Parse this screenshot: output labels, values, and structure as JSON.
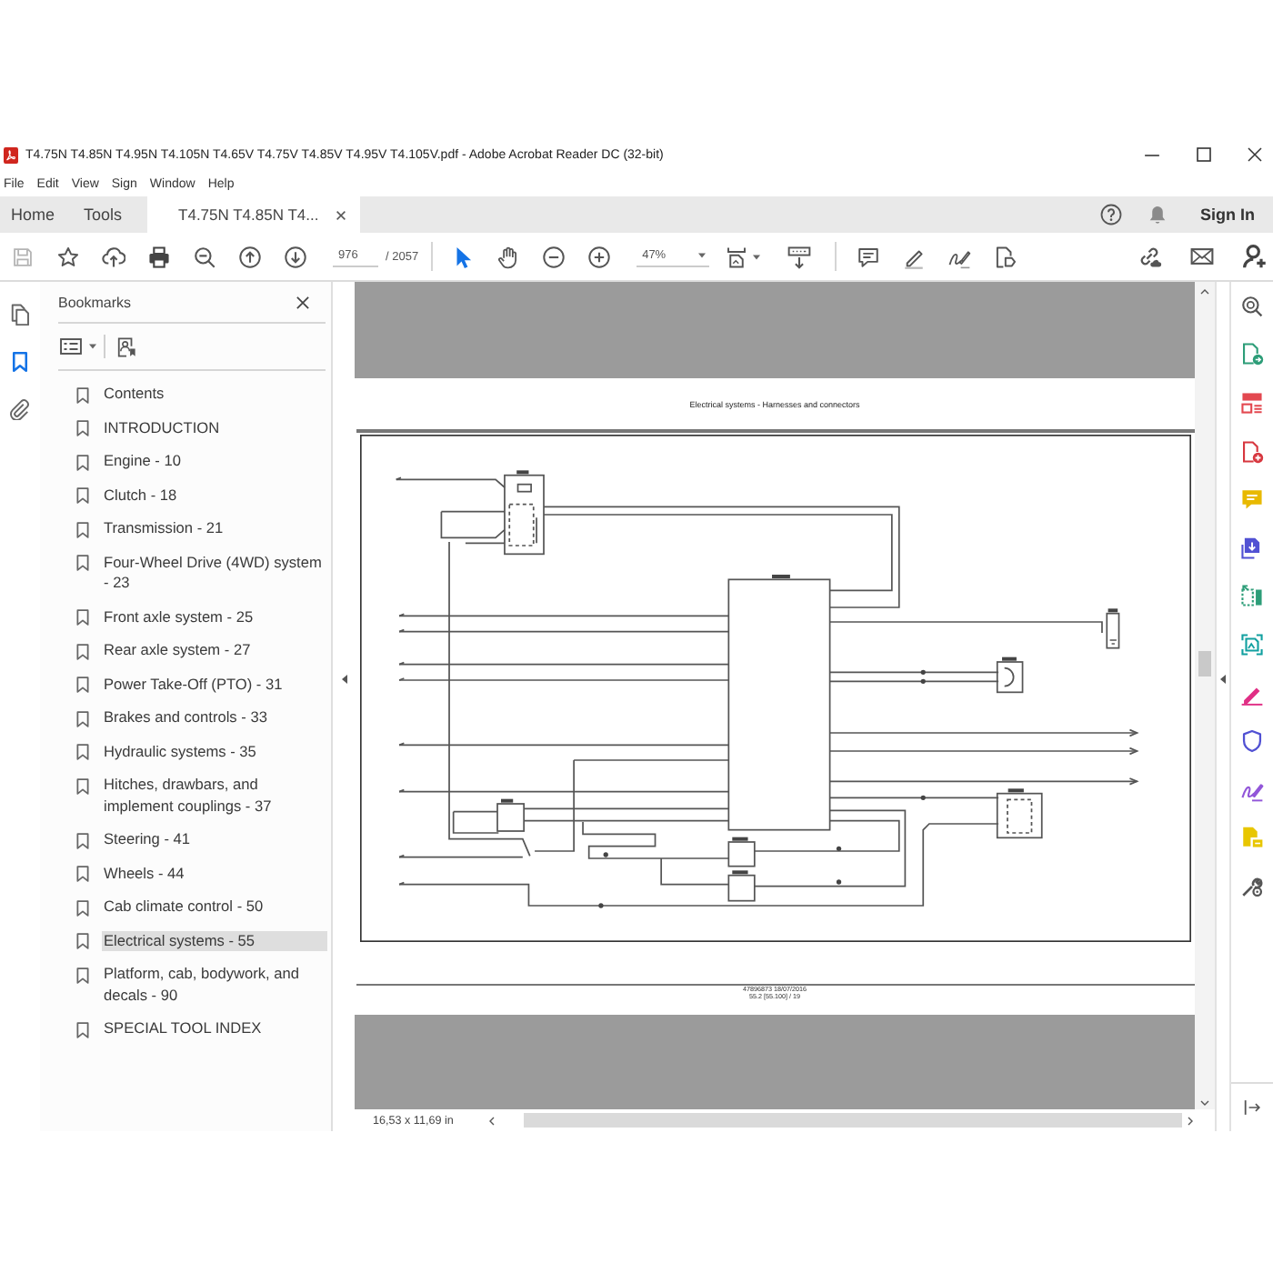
{
  "window": {
    "title": "T4.75N T4.85N T4.95N T4.105N T4.65V T4.75V T4.85V T4.95V T4.105V.pdf - Adobe Acrobat Reader DC (32-bit)"
  },
  "menu": [
    "File",
    "Edit",
    "View",
    "Sign",
    "Window",
    "Help"
  ],
  "tabs": [
    {
      "label": "Home",
      "kind": "nav",
      "selected": false
    },
    {
      "label": "Tools",
      "kind": "nav",
      "selected": false
    },
    {
      "label": "T4.75N T4.85N T4...",
      "kind": "document",
      "selected": true
    }
  ],
  "account": {
    "sign_in": "Sign In"
  },
  "toolbar": {
    "page_number": "976",
    "page_total": "/ 2057",
    "zoom": "47%"
  },
  "navigation_rail": [
    {
      "kind": "pages",
      "selected": false
    },
    {
      "kind": "bookmarks",
      "selected": true
    },
    {
      "kind": "attachments",
      "selected": false
    }
  ],
  "bookmarks_panel": {
    "title": "Bookmarks",
    "items": [
      {
        "label": "Contents",
        "selected": false
      },
      {
        "label": "INTRODUCTION",
        "selected": false
      },
      {
        "label": "Engine - 10",
        "selected": false
      },
      {
        "label": "Clutch - 18",
        "selected": false
      },
      {
        "label": "Transmission - 21",
        "selected": false
      },
      {
        "label": "Four-Wheel Drive (4WD) system - 23",
        "selected": false
      },
      {
        "label": "Front axle system - 25",
        "selected": false
      },
      {
        "label": "Rear axle system - 27",
        "selected": false
      },
      {
        "label": "Power Take-Off (PTO) - 31",
        "selected": false
      },
      {
        "label": "Brakes and controls - 33",
        "selected": false
      },
      {
        "label": "Hydraulic systems - 35",
        "selected": false
      },
      {
        "label": "Hitches, drawbars, and implement couplings - 37",
        "selected": false
      },
      {
        "label": "Steering - 41",
        "selected": false
      },
      {
        "label": "Wheels - 44",
        "selected": false
      },
      {
        "label": "Cab climate control - 50",
        "selected": false
      },
      {
        "label": "Electrical systems - 55",
        "selected": true
      },
      {
        "label": "Platform, cab, bodywork, and decals - 90",
        "selected": false
      },
      {
        "label": "SPECIAL TOOL INDEX",
        "selected": false
      }
    ]
  },
  "document": {
    "page_title": "Electrical systems - Harnesses and connectors",
    "footer_lines": [
      "47896873 18/07/2016",
      "55.2 [55.100] / 19"
    ]
  },
  "status_bar": {
    "page_size": "16,53 x 11,69 in"
  }
}
